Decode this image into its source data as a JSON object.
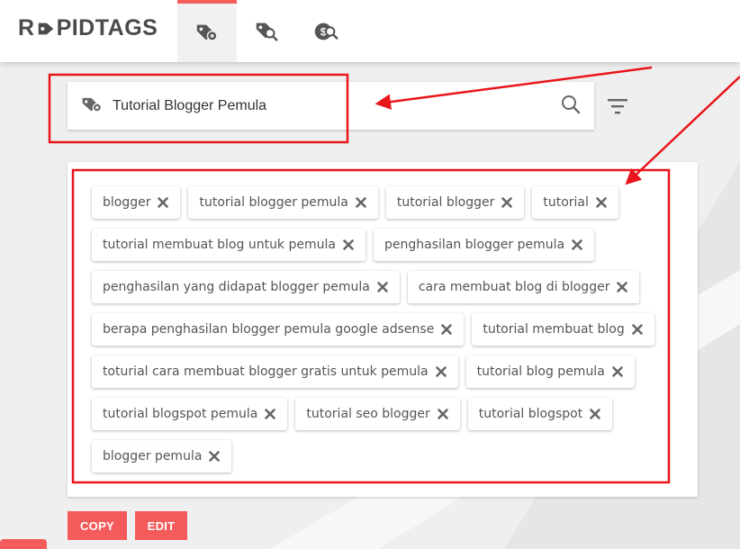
{
  "brand": {
    "logo_before": "R",
    "logo_after": "PIDTAGS",
    "accent_color": "#f45b5b",
    "text_color": "#4a4a4a"
  },
  "nav": {
    "tabs": [
      {
        "icon": "tag-gear-icon",
        "active": true
      },
      {
        "icon": "tag-search-icon",
        "active": false
      },
      {
        "icon": "money-search-icon",
        "active": false
      }
    ]
  },
  "search": {
    "icon": "tag-gear-icon",
    "value": "Tutorial Blogger Pemula",
    "search_icon": "search-icon",
    "filter_icon": "filter-icon"
  },
  "tags": [
    "blogger",
    "tutorial blogger pemula",
    "tutorial blogger",
    "tutorial",
    "tutorial membuat blog untuk pemula",
    "penghasilan blogger pemula",
    "penghasilan yang didapat blogger pemula",
    "cara membuat blog di blogger",
    "berapa penghasilan blogger pemula google adsense",
    "tutorial membuat blog",
    "toturial cara membuat blogger gratis untuk pemula",
    "tutorial blog pemula",
    "tutorial blogspot pemula",
    "tutorial seo blogger",
    "tutorial blogspot",
    "blogger pemula"
  ],
  "actions": {
    "copy_label": "COPY",
    "edit_label": "EDIT"
  },
  "annotation_color": "#e8151b"
}
